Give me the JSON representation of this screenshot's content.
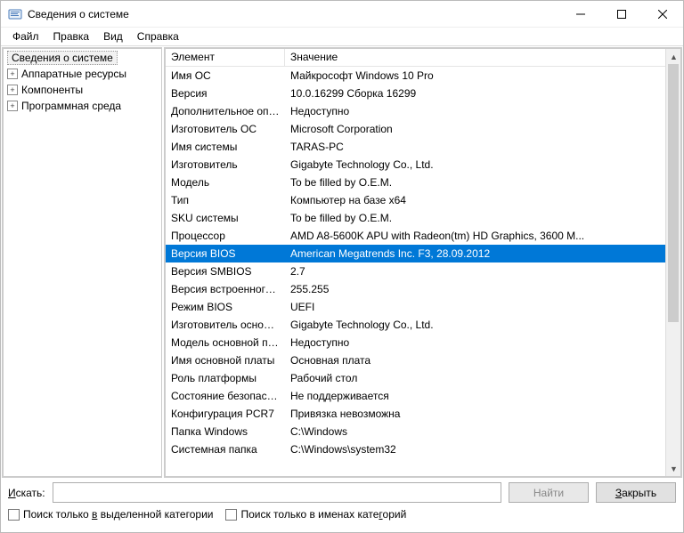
{
  "window": {
    "title": "Сведения о системе"
  },
  "menu": {
    "file": "Файл",
    "edit": "Правка",
    "view": "Вид",
    "help": "Справка"
  },
  "tree": {
    "root": "Сведения о системе",
    "hardware": "Аппаратные ресурсы",
    "components": "Компоненты",
    "software": "Программная среда"
  },
  "columns": {
    "name": "Элемент",
    "value": "Значение"
  },
  "rows": [
    {
      "name": "Имя ОС",
      "value": "Майкрософт Windows 10 Pro"
    },
    {
      "name": "Версия",
      "value": "10.0.16299 Сборка 16299"
    },
    {
      "name": "Дополнительное опис...",
      "value": "Недоступно"
    },
    {
      "name": "Изготовитель ОС",
      "value": "Microsoft Corporation"
    },
    {
      "name": "Имя системы",
      "value": "TARAS-PC"
    },
    {
      "name": "Изготовитель",
      "value": "Gigabyte Technology Co., Ltd."
    },
    {
      "name": "Модель",
      "value": "To be filled by O.E.M."
    },
    {
      "name": "Тип",
      "value": "Компьютер на базе x64"
    },
    {
      "name": "SKU системы",
      "value": "To be filled by O.E.M."
    },
    {
      "name": "Процессор",
      "value": "AMD A8-5600K APU with Radeon(tm) HD Graphics, 3600 М..."
    },
    {
      "name": "Версия BIOS",
      "value": "American Megatrends Inc. F3, 28.09.2012",
      "selected": true
    },
    {
      "name": "Версия SMBIOS",
      "value": "2.7"
    },
    {
      "name": "Версия встроенного к...",
      "value": "255.255"
    },
    {
      "name": "Режим BIOS",
      "value": "UEFI"
    },
    {
      "name": "Изготовитель основно...",
      "value": "Gigabyte Technology Co., Ltd."
    },
    {
      "name": "Модель основной пла...",
      "value": "Недоступно"
    },
    {
      "name": "Имя основной платы",
      "value": "Основная плата"
    },
    {
      "name": "Роль платформы",
      "value": "Рабочий стол"
    },
    {
      "name": "Состояние безопасно...",
      "value": "Не поддерживается"
    },
    {
      "name": "Конфигурация PCR7",
      "value": "Привязка невозможна"
    },
    {
      "name": "Папка Windows",
      "value": "C:\\Windows"
    },
    {
      "name": "Системная папка",
      "value": "C:\\Windows\\system32"
    }
  ],
  "search": {
    "label_pre": "Искать:",
    "label_accel": "И",
    "find": "Найти",
    "close": "Закрыть",
    "close_accel": "З",
    "chk_selected": "Поиск только в выделенной категории",
    "chk_names": "Поиск только в именах категорий"
  }
}
